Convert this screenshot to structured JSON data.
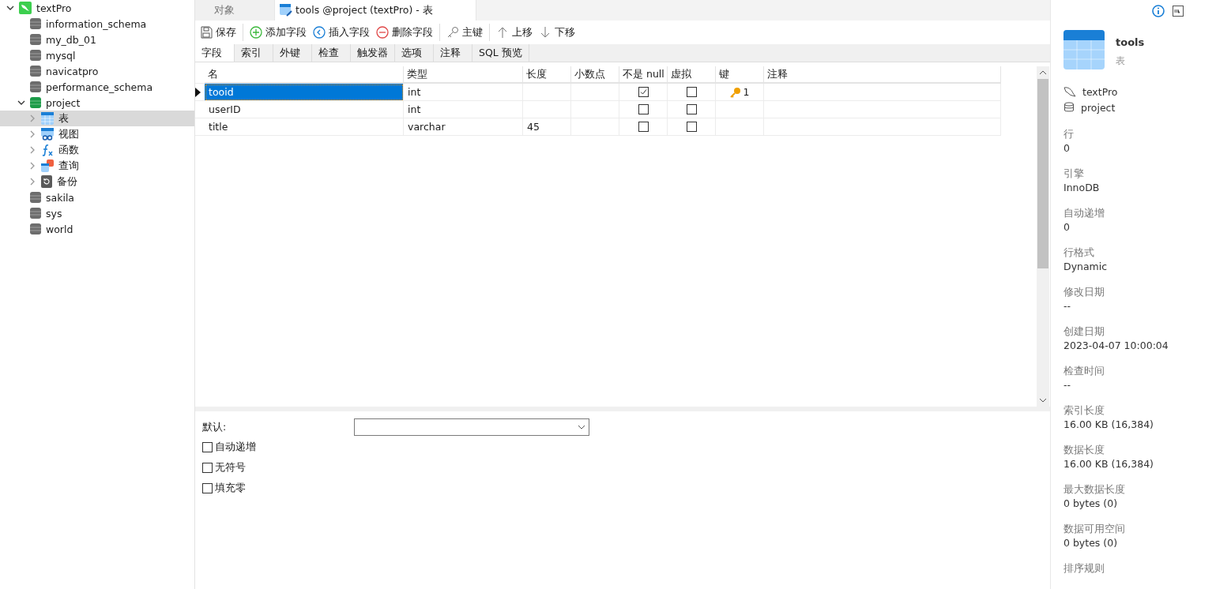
{
  "tree": [
    {
      "kind": "connection",
      "label": "textPro",
      "expanded": true,
      "selected": false,
      "children": [
        {
          "kind": "database",
          "label": "information_schema",
          "selected": false
        },
        {
          "kind": "database",
          "label": "my_db_01",
          "selected": false
        },
        {
          "kind": "database",
          "label": "mysql",
          "selected": false
        },
        {
          "kind": "database",
          "label": "navicatpro",
          "selected": false
        },
        {
          "kind": "database",
          "label": "performance_schema",
          "selected": false
        },
        {
          "kind": "database-open",
          "label": "project",
          "expanded": true,
          "selected": false,
          "children": [
            {
              "kind": "table",
              "label": "表",
              "expanded": false,
              "selected": true
            },
            {
              "kind": "view",
              "label": "视图",
              "expanded": false,
              "selected": false
            },
            {
              "kind": "function",
              "label": "函数",
              "expanded": false,
              "selected": false
            },
            {
              "kind": "query",
              "label": "查询",
              "expanded": false,
              "selected": false
            },
            {
              "kind": "backup",
              "label": "备份",
              "expanded": false,
              "selected": false
            }
          ]
        },
        {
          "kind": "database",
          "label": "sakila",
          "selected": false
        },
        {
          "kind": "database",
          "label": "sys",
          "selected": false
        },
        {
          "kind": "database",
          "label": "world",
          "selected": false
        }
      ]
    }
  ],
  "doc_tabs": [
    {
      "label": "对象",
      "selected": false,
      "icon": false
    },
    {
      "label": "tools @project (textPro) - 表",
      "selected": true,
      "icon": true
    }
  ],
  "toolbar": [
    {
      "kind": "save",
      "label": "保存",
      "separator_after": true
    },
    {
      "kind": "add",
      "label": "添加字段"
    },
    {
      "kind": "insert",
      "label": "插入字段"
    },
    {
      "kind": "delete",
      "label": "删除字段",
      "separator_after": true
    },
    {
      "kind": "key",
      "label": "主键",
      "separator_after": true
    },
    {
      "kind": "up",
      "label": "上移"
    },
    {
      "kind": "down",
      "label": "下移"
    }
  ],
  "sub_tabs": [
    {
      "label": "字段",
      "selected": true
    },
    {
      "label": "索引",
      "selected": false
    },
    {
      "label": "外键",
      "selected": false
    },
    {
      "label": "检查",
      "selected": false
    },
    {
      "label": "触发器",
      "selected": false
    },
    {
      "label": "选项",
      "selected": false
    },
    {
      "label": "注释",
      "selected": false
    },
    {
      "label": "SQL 预览",
      "selected": false
    }
  ],
  "grid": {
    "columns": [
      "名",
      "类型",
      "长度",
      "小数点",
      "不是 null",
      "虚拟",
      "键",
      "注释"
    ],
    "rows": [
      {
        "name": "tooid",
        "type": "int",
        "length": "",
        "decimals": "",
        "not_null": true,
        "virtual": false,
        "key": "1",
        "comment": "",
        "selected": true
      },
      {
        "name": "userID",
        "type": "int",
        "length": "",
        "decimals": "",
        "not_null": false,
        "virtual": false,
        "key": "",
        "comment": "",
        "selected": false
      },
      {
        "name": "title",
        "type": "varchar",
        "length": "45",
        "decimals": "",
        "not_null": false,
        "virtual": false,
        "key": "",
        "comment": "",
        "selected": false
      }
    ]
  },
  "field_props": {
    "default_label": "默认:",
    "options": [
      {
        "label": "自动递增",
        "checked": false
      },
      {
        "label": "无符号",
        "checked": false
      },
      {
        "label": "填充零",
        "checked": false
      }
    ]
  },
  "info": {
    "name": "tools",
    "type": "表",
    "connection": "textPro",
    "database": "project",
    "props": [
      {
        "label": "行",
        "value": "0"
      },
      {
        "label": "引擎",
        "value": "InnoDB"
      },
      {
        "label": "自动递增",
        "value": "0"
      },
      {
        "label": "行格式",
        "value": "Dynamic"
      },
      {
        "label": "修改日期",
        "value": "--"
      },
      {
        "label": "创建日期",
        "value": "2023-04-07 10:00:04"
      },
      {
        "label": "检查时间",
        "value": "--"
      },
      {
        "label": "索引长度",
        "value": "16.00 KB (16,384)"
      },
      {
        "label": "数据长度",
        "value": "16.00 KB (16,384)"
      },
      {
        "label": "最大数据长度",
        "value": "0 bytes (0)"
      },
      {
        "label": "数据可用空间",
        "value": "0 bytes (0)"
      },
      {
        "label": "排序规则"
      }
    ]
  }
}
